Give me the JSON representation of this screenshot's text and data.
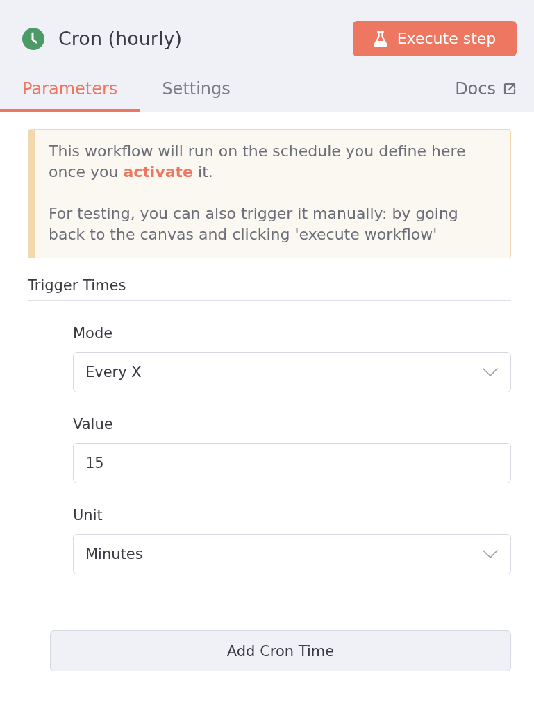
{
  "header": {
    "title": "Cron (hourly)",
    "execute_button": "Execute step"
  },
  "tabs": [
    {
      "label": "Parameters",
      "selected": true
    },
    {
      "label": "Settings",
      "selected": false
    }
  ],
  "docs_link": "Docs",
  "notice": {
    "paragraphs": [
      {
        "segments": [
          {
            "kind": "text",
            "text": "This workflow will run on the schedule you define here once you"
          },
          {
            "kind": "link",
            "text": "activate"
          },
          {
            "kind": "text",
            "text": "it."
          }
        ]
      },
      {
        "segments": [
          {
            "kind": "text",
            "text": "For testing, you can also trigger it manually: by going back to the canvas and clicking 'execute workflow'"
          }
        ]
      }
    ]
  },
  "section": {
    "title": "Trigger Times",
    "fields": [
      {
        "kind": "select",
        "label": "Mode",
        "value": "Every X"
      },
      {
        "kind": "input",
        "label": "Value",
        "value": "15"
      },
      {
        "kind": "select",
        "label": "Unit",
        "value": "Minutes"
      }
    ],
    "add_button": "Add Cron Time"
  }
}
